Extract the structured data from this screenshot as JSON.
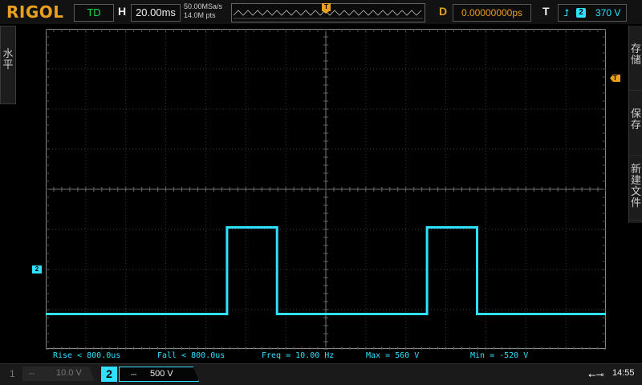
{
  "header": {
    "brand": "RIGOL",
    "run_state": "TD",
    "horizontal_label": "H",
    "timebase": "20.00ms",
    "sample_rate": "50.00MSa/s",
    "memory_depth": "14.0M pts",
    "delay_label": "D",
    "delay_value": "0.00000000ps",
    "trigger_label": "T",
    "trigger_channel": "2",
    "trigger_level": "370 V"
  },
  "side_left": {
    "label": "水\n平"
  },
  "side_right": {
    "items": [
      {
        "label": "存\n储"
      },
      {
        "label": "保\n存"
      },
      {
        "label": "新\n建\n文\n件"
      }
    ]
  },
  "markers": {
    "trigger_level": "T",
    "channel2_ground": "2",
    "trigger_position": "T"
  },
  "waveform": {
    "channel": 2,
    "color": "#30e0ff",
    "high_volts": 560,
    "low_volts": -520,
    "frequency_hz": 10,
    "period_ms": 100,
    "duty_cycle": 0.25,
    "volts_per_div": 500,
    "ms_per_div": 20,
    "ground_offset_div": -2.07,
    "first_rising_edge_ms": -49.4,
    "trigger_level_volts": 370
  },
  "measurements": {
    "rise": "Rise < 800.0us",
    "fall": "Fall < 800.0us",
    "freq": "Freq = 10.00 Hz",
    "max": "Max = 560 V",
    "min": "Min = -520 V"
  },
  "channels": {
    "ch1": {
      "number": "1",
      "coupling": "⎓",
      "scale": "10.0 V",
      "active": false
    },
    "ch2": {
      "number": "2",
      "coupling": "⎓",
      "scale": "500 V",
      "active": true
    }
  },
  "status": {
    "usb_icon": "usb-icon",
    "time": "14:55"
  },
  "colors": {
    "accent": "#e8a020",
    "channel2": "#30e0ff",
    "run_state": "#1fd14a"
  }
}
